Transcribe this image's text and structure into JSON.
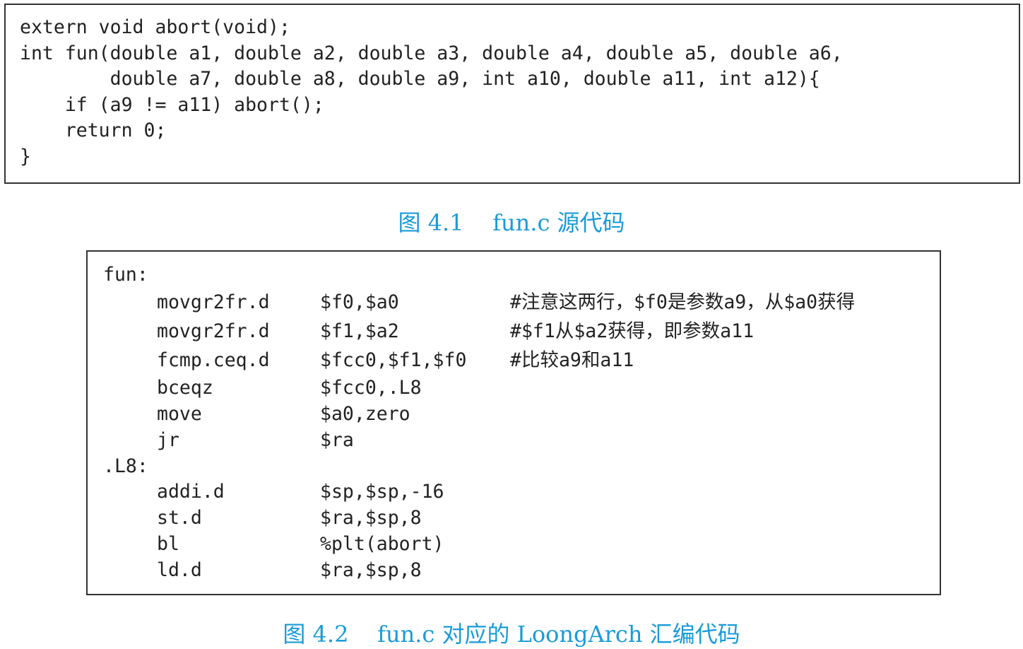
{
  "source_code": {
    "lines": [
      "extern void abort(void);",
      "int fun(double a1, double a2, double a3, double a4, double a5, double a6,",
      "        double a7, double a8, double a9, int a10, double a11, int a12){",
      "    if (a9 != a11) abort();",
      "    return 0;",
      "}"
    ]
  },
  "caption1": "图 4.1    fun.c 源代码",
  "assembly": {
    "label_fun": "fun:",
    "label_l8": ".L8:",
    "rows": [
      {
        "instr": "movgr2fr.d",
        "ops": "$f0,$a0",
        "comment": "#注意这两行，$f0是参数a9，从$a0获得"
      },
      {
        "instr": "movgr2fr.d",
        "ops": "$f1,$a2",
        "comment": "#$f1从$a2获得，即参数a11"
      },
      {
        "instr": "fcmp.ceq.d",
        "ops": "$fcc0,$f1,$f0",
        "comment": "#比较a9和a11"
      },
      {
        "instr": "bceqz",
        "ops": "$fcc0,.L8",
        "comment": ""
      },
      {
        "instr": "move",
        "ops": "$a0,zero",
        "comment": ""
      },
      {
        "instr": "jr",
        "ops": "$ra",
        "comment": ""
      },
      {
        "instr": "addi.d",
        "ops": "$sp,$sp,-16",
        "comment": ""
      },
      {
        "instr": "st.d",
        "ops": "$ra,$sp,8",
        "comment": ""
      },
      {
        "instr": "bl",
        "ops": "%plt(abort)",
        "comment": ""
      },
      {
        "instr": "ld.d",
        "ops": "$ra,$sp,8",
        "comment": ""
      }
    ]
  },
  "caption2": "图 4.2    fun.c 对应的 LoongArch 汇编代码",
  "colors": {
    "caption": "#1a9bd7",
    "border": "#333333",
    "text": "#222222"
  }
}
